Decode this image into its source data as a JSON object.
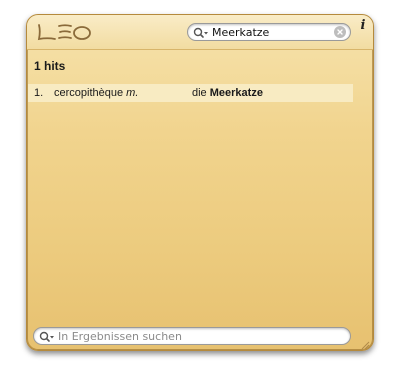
{
  "header": {
    "logo_text": "LEO",
    "search": {
      "value": "Meerkatze",
      "icon": "magnifier-dropdown-icon",
      "clear_icon": "clear-icon"
    },
    "info_label": "i"
  },
  "results": {
    "count_label": "1 hits",
    "rows": [
      {
        "index": "1.",
        "source_word": "cercopithèque",
        "source_gender": "m.",
        "target_article": "die",
        "target_word": "Meerkatze"
      }
    ]
  },
  "footer": {
    "filter_placeholder": "In Ergebnissen suchen",
    "icon": "magnifier-dropdown-icon"
  },
  "colors": {
    "panel_top": "#f6e3ad",
    "panel_bottom": "#e7c170",
    "row_highlight": "#f8ebc2",
    "border": "#b58a3c"
  }
}
